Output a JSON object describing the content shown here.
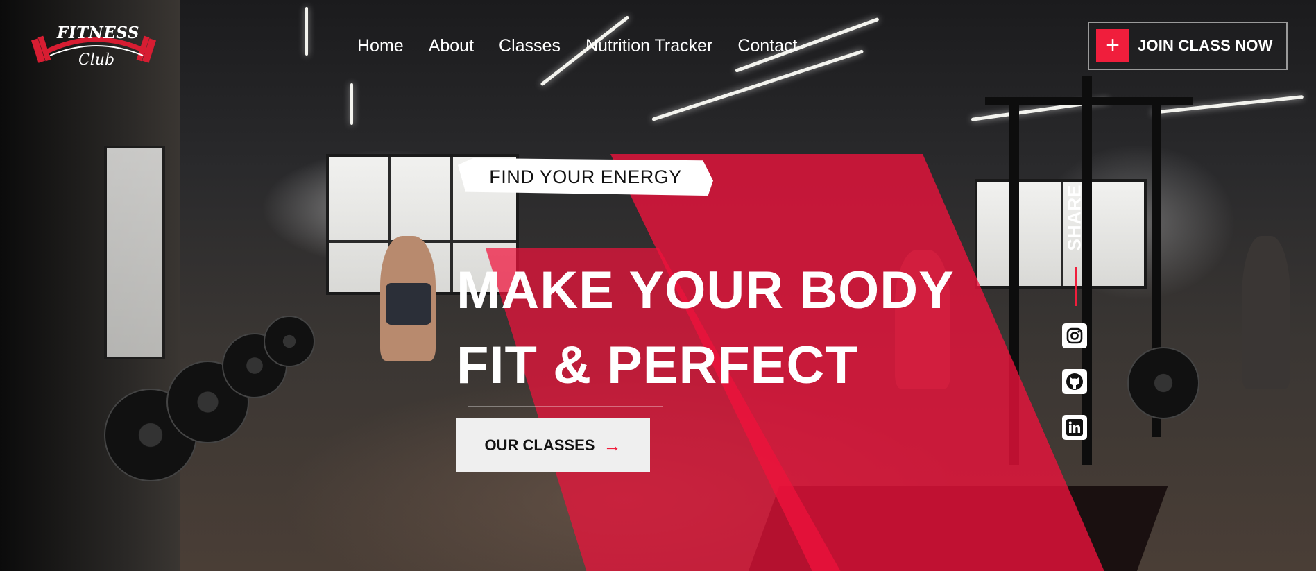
{
  "brand": {
    "logo_top": "FITNESS",
    "logo_bottom": "Club",
    "accent": "#f01e3c"
  },
  "nav": {
    "items": [
      "Home",
      "About",
      "Classes",
      "Nutrition Tracker",
      "Contact"
    ]
  },
  "header": {
    "join_icon": "plus-icon",
    "join_label": "JOIN CLASS NOW"
  },
  "hero": {
    "tagline": "FIND YOUR ENERGY",
    "headline_line1": "MAKE YOUR BODY",
    "headline_line2": "FIT & PERFECT",
    "cta_label": "OUR CLASSES",
    "cta_icon": "arrow-right-icon"
  },
  "share": {
    "label": "SHARE",
    "icons": [
      "instagram-icon",
      "github-icon",
      "linkedin-icon"
    ]
  }
}
